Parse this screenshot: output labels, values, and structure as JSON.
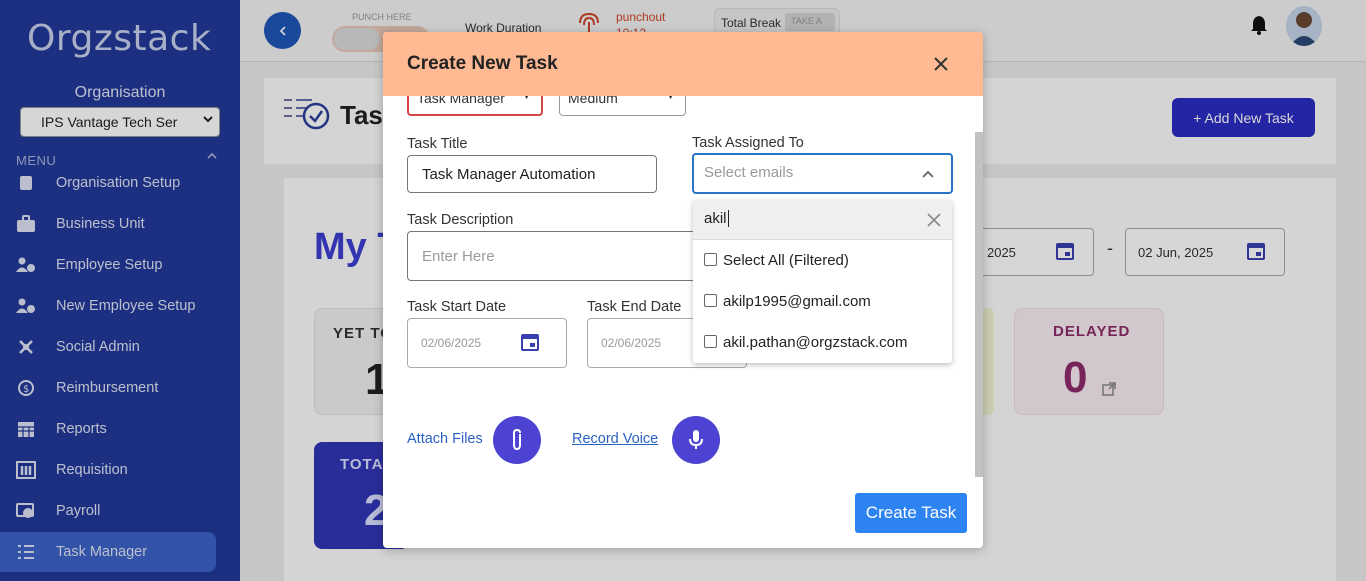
{
  "sidebar": {
    "logo": "Orgzstack",
    "org_label": "Organisation",
    "org_selected": "IPS Vantage Tech Ser",
    "menu_label": "MENU",
    "items": [
      {
        "label": "Organisation Setup",
        "icon": "org-setup-icon"
      },
      {
        "label": "Business Unit",
        "icon": "briefcase-icon"
      },
      {
        "label": "Employee Setup",
        "icon": "users-gear-icon"
      },
      {
        "label": "New Employee Setup",
        "icon": "user-plus-icon"
      },
      {
        "label": "Social Admin",
        "icon": "social-icon"
      },
      {
        "label": "Reimbursement",
        "icon": "reimbursement-icon"
      },
      {
        "label": "Reports",
        "icon": "calendar-grid-icon"
      },
      {
        "label": "Requisition",
        "icon": "requisition-icon"
      },
      {
        "label": "Payroll",
        "icon": "payroll-icon"
      },
      {
        "label": "Task Manager",
        "icon": "list-icon",
        "active": true
      }
    ]
  },
  "topbar": {
    "punch_here": "PUNCH HERE",
    "work_duration": "Work Duration",
    "punchout": "punchout",
    "punch_time": "10:12",
    "total_break": "Total Break",
    "take_a": "TAKE A"
  },
  "background": {
    "page_title": "Task",
    "add_task": "+ Add New Task",
    "my_tasks": "My T",
    "date_from": "ay, 2025",
    "date_sep": "-",
    "date_to": "02 Jun, 2025",
    "yet_label": "YET TO",
    "yet_value": "1",
    "delayed_label": "DELAYED",
    "delayed_value": "0",
    "total_label": "TOTA",
    "total_value": "2"
  },
  "modal": {
    "title": "Create New Task",
    "top_select_1": "Task Manager",
    "top_select_2": "Medium",
    "task_title_label": "Task Title",
    "task_title_value": "Task Manager Automation",
    "assigned_label": "Task Assigned To",
    "assigned_placeholder": "Select emails",
    "desc_label": "Task Description",
    "desc_placeholder": "Enter Here",
    "start_label": "Task Start Date",
    "start_value": "02/06/2025",
    "end_label": "Task End Date",
    "end_value": "02/06/2025",
    "attach_label": "Attach Files",
    "record_label": "Record Voice",
    "create_label": "Create Task",
    "dropdown": {
      "search_value": "akil",
      "options": [
        "Select All (Filtered)",
        "akilp1995@gmail.com",
        "akil.pathan@orgzstack.com"
      ]
    }
  },
  "colors": {
    "sidebar": "#23399a",
    "modal_header": "#ffba93",
    "primary": "#2e83f2",
    "accent_round": "#4c43d2"
  }
}
